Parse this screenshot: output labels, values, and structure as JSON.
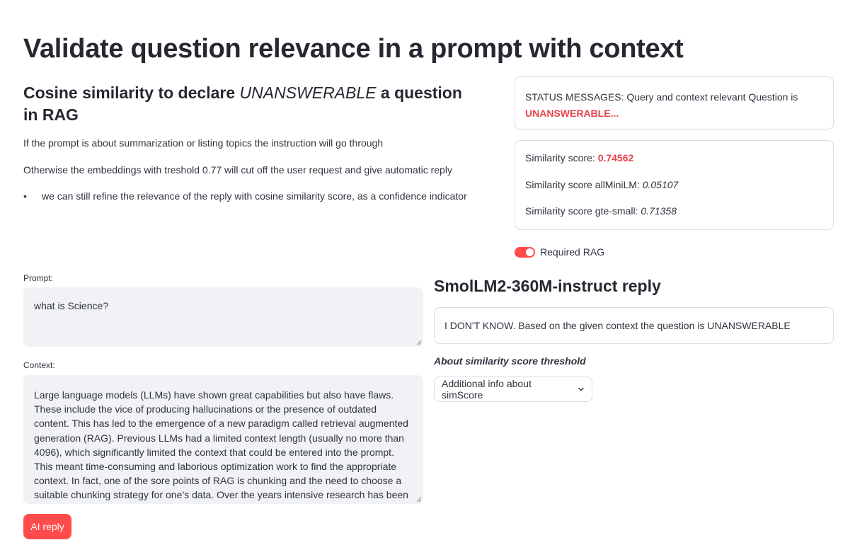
{
  "page": {
    "title": "Validate question relevance in a prompt with context"
  },
  "intro": {
    "subtitle_pre": "Cosine similarity to declare ",
    "subtitle_em": "UNANSWERABLE",
    "subtitle_post": " a question in RAG",
    "paragraph_1": "If the prompt is about summarization or listing topics the instruction will go through",
    "paragraph_2": "Otherwise the embeddings with treshold 0.77 will cut off the user request and give automatic reply",
    "bullet_1": "we can still refine the relevance of the reply with cosine similarity score, as a confidence indicator"
  },
  "status": {
    "prefix": "STATUS MESSAGES: Query and context relevant Question is ",
    "value": "UNANSWERABLE..."
  },
  "scores": {
    "similarity_label": "Similarity score: ",
    "similarity_value": "0.74562",
    "allminilm_label": "Similarity score allMiniLM: ",
    "allminilm_value": "0.05107",
    "gte_label": "Similarity score gte-small: ",
    "gte_value": "0.71358"
  },
  "toggle": {
    "label": "Required RAG",
    "on": true
  },
  "prompt": {
    "label": "Prompt:",
    "value": "what is Science?"
  },
  "context": {
    "label": "Context:",
    "value": "Large language models (LLMs) have shown great capabilities but also have flaws. These include the vice of producing hallucinations or the presence of outdated content. This has led to the emergence of a new paradigm called retrieval augmented generation (RAG). Previous LLMs had a limited context length (usually no more than 4096), which significantly limited the context that could be entered into the prompt. This meant time-consuming and laborious optimization work to find the appropriate context. In fact, one of the sore points of RAG is chunking and the need to choose a suitable chunking strategy for one’s data. Over the years intensive research has been devoted to extending"
  },
  "actions": {
    "ai_reply_label": "AI reply"
  },
  "reply": {
    "title": "SmolLM2-360M-instruct reply",
    "text": "I DON'T KNOW. Based on the given context the question is UNANSWERABLE"
  },
  "about": {
    "label": "About similarity score threshold",
    "expander_label": "Additional info about simScore"
  },
  "colors": {
    "accent": "#ff4b4b",
    "status_red": "#e8434e",
    "input_bg": "#f0f2f6",
    "border": "#dcdde3"
  },
  "icons": {
    "expander": "chevron-down-icon",
    "resize": "resize-handle-icon"
  }
}
